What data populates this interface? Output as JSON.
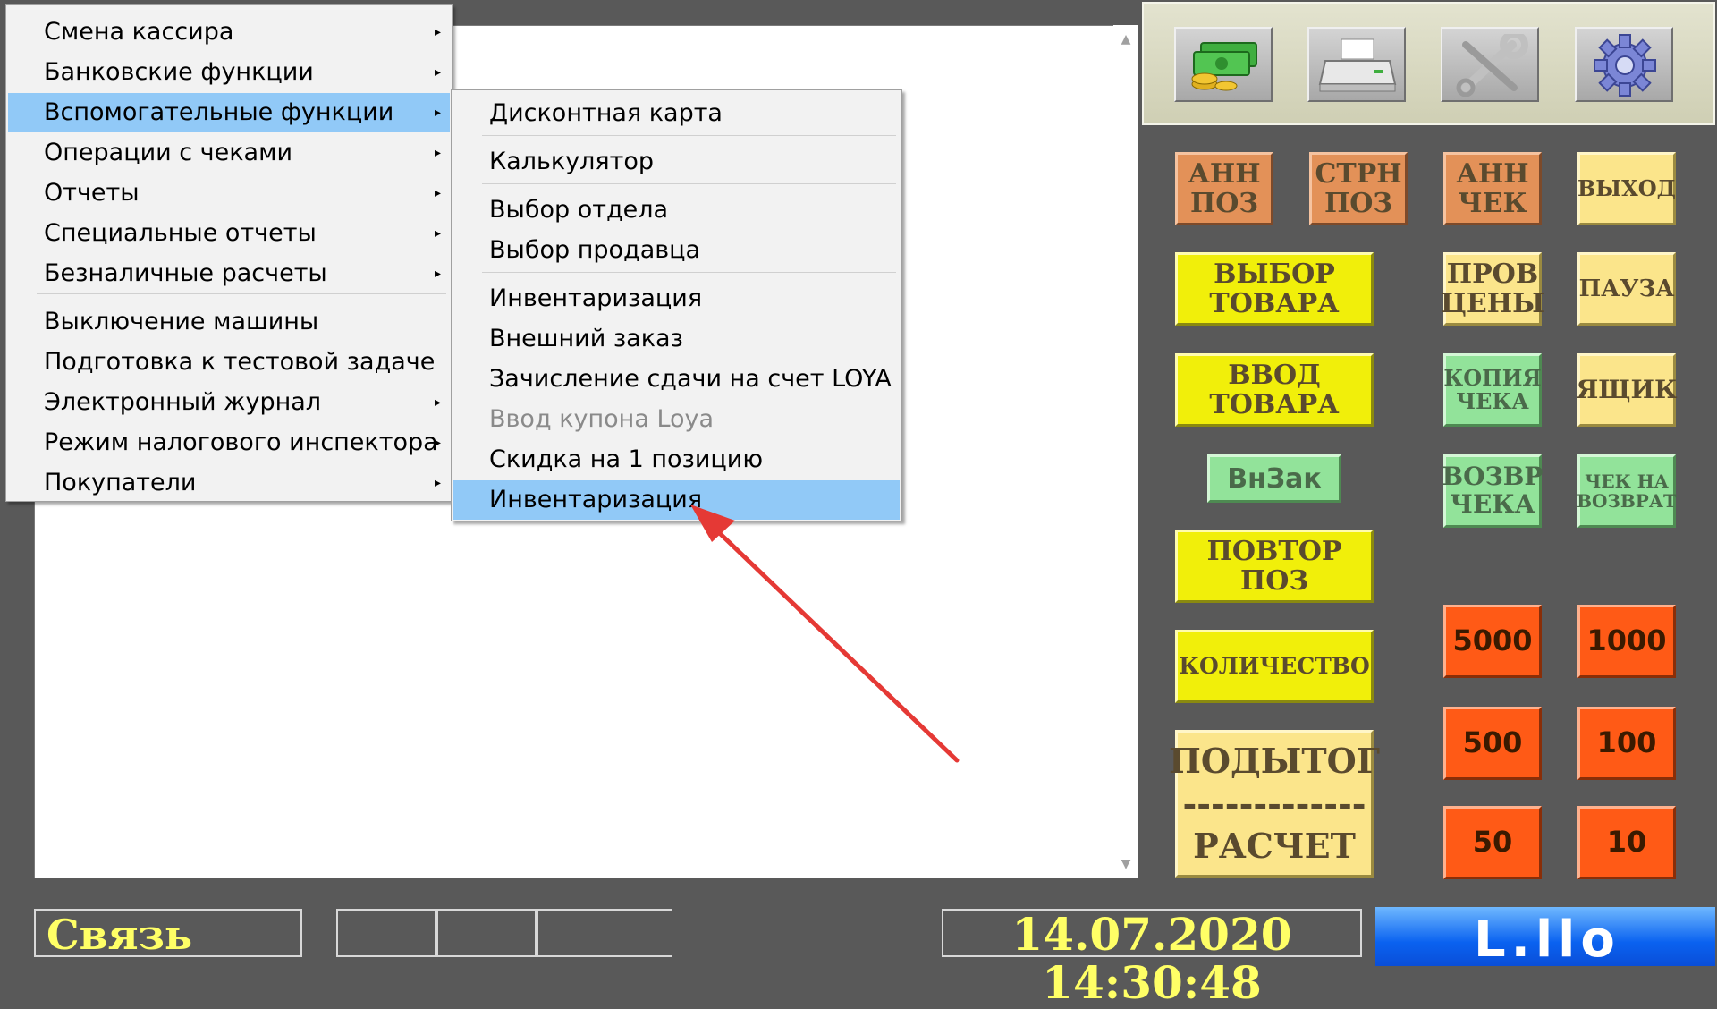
{
  "menu_main": {
    "items": [
      {
        "label": "Смена кассира",
        "arrow": true
      },
      {
        "label": "Банковские функции",
        "arrow": true
      },
      {
        "label": "Вспомогательные функции",
        "arrow": true,
        "selected": true
      },
      {
        "label": "Операции с чеками",
        "arrow": true
      },
      {
        "label": "Отчеты",
        "arrow": true
      },
      {
        "label": "Специальные отчеты",
        "arrow": true
      },
      {
        "label": "Безналичные расчеты",
        "arrow": true
      },
      {
        "label": "Выключение машины",
        "arrow": false
      },
      {
        "label": "Подготовка к тестовой задаче",
        "arrow": false
      },
      {
        "label": "Электронный журнал",
        "arrow": true
      },
      {
        "label": "Режим налогового инспектора",
        "arrow": true
      },
      {
        "label": "Покупатели",
        "arrow": true
      }
    ]
  },
  "menu_sub": {
    "items": [
      {
        "label": "Дисконтная карта"
      },
      {
        "label": "Калькулятор"
      },
      {
        "label": "Выбор отдела"
      },
      {
        "label": "Выбор продавца"
      },
      {
        "label": "Инвентаризация"
      },
      {
        "label": "Внешний заказ"
      },
      {
        "label": "Зачисление сдачи на счет LOYA"
      },
      {
        "label": "Ввод купона Loya",
        "disabled": true
      },
      {
        "label": "Скидка на 1 позицию"
      },
      {
        "label": "Инвентаризация",
        "selected": true
      }
    ]
  },
  "menu_arrow_glyph": "▸",
  "toolbar": {
    "icons": [
      "money-icon",
      "printer-icon",
      "wrench-icon",
      "gear-icon"
    ]
  },
  "pos_buttons": {
    "ann_poz": "АНН\nПОЗ",
    "strn_poz": "СТРН\nПОЗ",
    "ann_chek": "АНН\nЧЕК",
    "exit": "ВЫХОД",
    "select_item": "ВЫБОР\nТОВАРА",
    "check_price": "ПРОВ\nЦЕНЫ",
    "pause": "ПАУЗА",
    "enter_item": "ВВОД\nТОВАРА",
    "receipt_copy": "КОПИЯ\nЧЕКА",
    "drawer": "ЯЩИК",
    "vnzak": "ВнЗак",
    "receipt_return": "ВОЗВР\nЧЕКА",
    "return_receipt": "ЧЕК НА\nВОЗВРАТ",
    "repeat_poz": "ПОВТОР\nПОЗ",
    "quantity": "КОЛИЧЕСТВО",
    "subtotal": "ПОДЫТОГ\n-------------\nРАСЧЕТ",
    "n5000": "5000",
    "n1000": "1000",
    "n500": "500",
    "n100": "100",
    "n50": "50",
    "n10": "10"
  },
  "status": {
    "connection": "Связь",
    "datetime": "14.07.2020 14:30:48",
    "logo_text": "L.llo"
  },
  "colors": {
    "annotation_arrow": "#e53935",
    "selection": "#91c9f7"
  }
}
